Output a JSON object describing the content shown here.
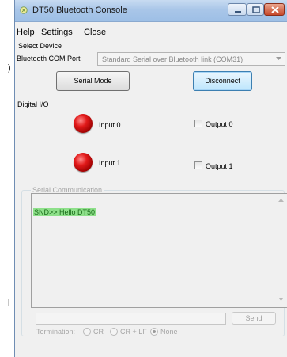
{
  "window": {
    "title": "DT50 Bluetooth Console"
  },
  "menu": [
    "Help",
    "Settings",
    "Close"
  ],
  "select_device": {
    "group_label": "Select Device",
    "port_label": "Bluetooth COM Port",
    "port_value": "Standard Serial over Bluetooth link (COM31)",
    "serial_mode_label": "Serial Mode",
    "disconnect_label": "Disconnect"
  },
  "digital_io": {
    "group_label": "Digital I/O",
    "inputs": [
      "Input 0",
      "Input 1"
    ],
    "outputs": [
      "Output 0",
      "Output 1"
    ],
    "output_checked": [
      false,
      false
    ]
  },
  "serial": {
    "group_label": "Serial Communication",
    "log_line": "SND>> Hello DT50",
    "send_label": "Send",
    "send_value": "",
    "termination_label": "Termination:",
    "termination_options": [
      "CR",
      "CR + LF",
      "None"
    ],
    "termination_selected": "None"
  },
  "colors": {
    "led": "#e21a1a",
    "sent_highlight": "#8ee08a",
    "titlebar": "#a9c6e8"
  },
  "icons": [
    "bluetooth-app-icon",
    "minimize-icon",
    "maximize-icon",
    "close-icon",
    "dropdown-arrow-icon",
    "scroll-up-icon",
    "scroll-down-icon"
  ]
}
